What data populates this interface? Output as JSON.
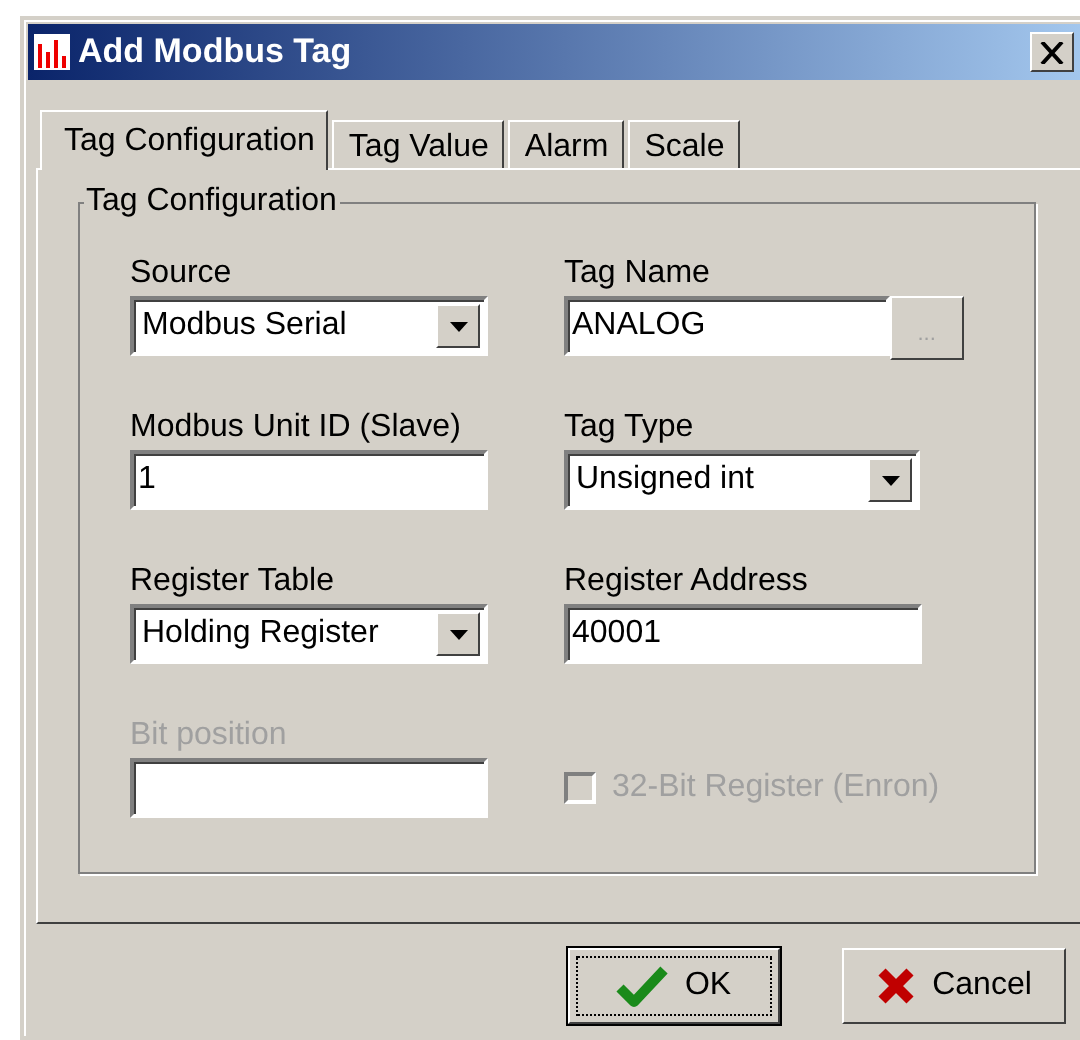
{
  "window": {
    "title": "Add Modbus Tag"
  },
  "tabs": [
    {
      "label": "Tag Configuration",
      "selected": true
    },
    {
      "label": "Tag Value",
      "selected": false
    },
    {
      "label": "Alarm",
      "selected": false
    },
    {
      "label": "Scale",
      "selected": false
    }
  ],
  "group": {
    "title": "Tag Configuration"
  },
  "fields": [
    {
      "kind": "select",
      "label": "Source",
      "value": "Modbus Serial",
      "disabled": false
    },
    {
      "kind": "browse",
      "label": "Tag Name",
      "value": "ANALOG",
      "browse": "...",
      "disabled": false
    },
    {
      "kind": "text",
      "label": "Modbus Unit ID (Slave)",
      "value": "1",
      "disabled": false
    },
    {
      "kind": "select",
      "label": "Tag Type",
      "value": "Unsigned int",
      "disabled": false
    },
    {
      "kind": "select",
      "label": "Register Table",
      "value": "Holding Register",
      "disabled": false
    },
    {
      "kind": "text",
      "label": "Register Address",
      "value": "40001",
      "disabled": false
    },
    {
      "kind": "text",
      "label": "Bit position",
      "disabled": true
    },
    {
      "kind": "checkbox",
      "label": "32-Bit Register (Enron)",
      "checked": false,
      "disabled": true
    }
  ],
  "buttons": [
    {
      "kind": "ok",
      "label": "OK",
      "focused": true
    },
    {
      "kind": "cancel",
      "label": "Cancel",
      "focused": false
    }
  ]
}
